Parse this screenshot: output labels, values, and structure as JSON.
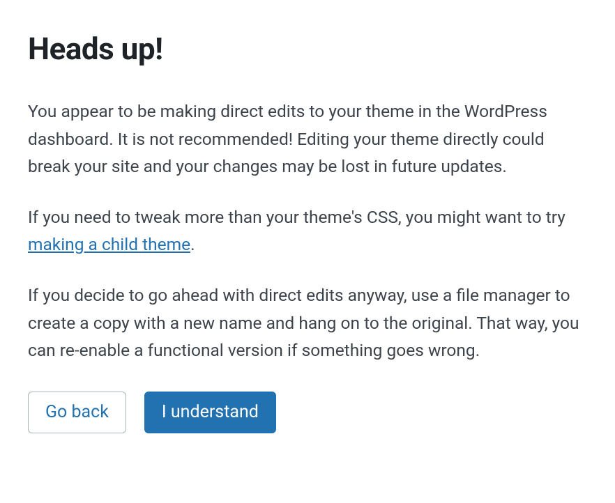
{
  "dialog": {
    "title": "Heads up!",
    "paragraph1": "You appear to be making direct edits to your theme in the WordPress dashboard. It is not recommended! Editing your theme directly could break your site and your changes may be lost in future updates.",
    "paragraph2_pre": "If you need to tweak more than your theme's CSS, you might want to try ",
    "paragraph2_link": "making a child theme",
    "paragraph2_post": ".",
    "paragraph3": "If you decide to go ahead with direct edits anyway, use a file manager to create a copy with a new name and hang on to the original. That way, you can re-enable a functional version if something goes wrong.",
    "buttons": {
      "go_back": "Go back",
      "understand": "I understand"
    }
  }
}
